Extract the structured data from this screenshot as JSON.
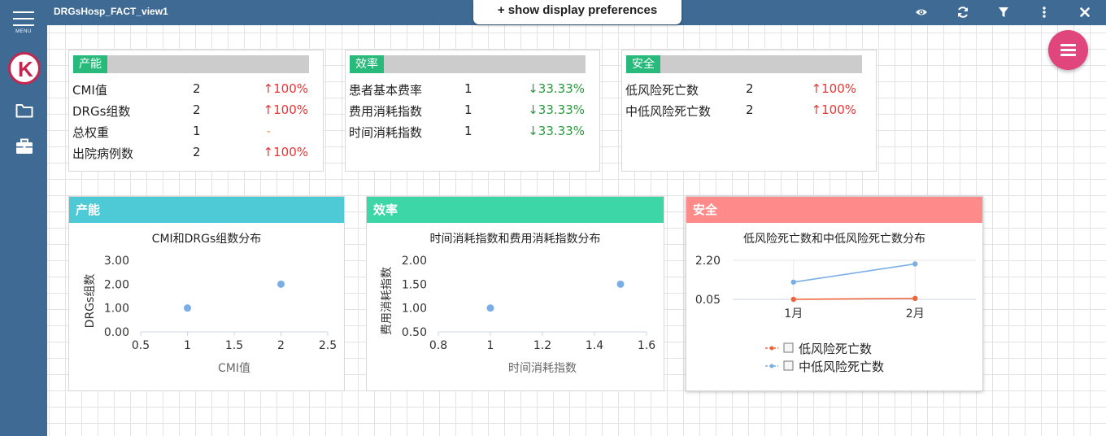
{
  "app": {
    "menu_label": "MENU",
    "view_title": "DRGsHosp_FACT_view1",
    "prefs_label": "+ show display preferences",
    "logo_letter": "K"
  },
  "icons": [
    "menu-icon",
    "folder-icon",
    "briefcase-icon",
    "eye-icon",
    "refresh-icon",
    "filter-icon",
    "more-vert-icon",
    "close-icon",
    "hamburger-icon"
  ],
  "colors": {
    "nav": "#3e6a93",
    "fab": "#e0457b",
    "kpi_tag": "#27ba7b",
    "capacity": "#4ec9d6",
    "efficiency": "#3dd6a7",
    "safety": "#ff8a8a",
    "up": "#ee3333",
    "down": "#2a9a3e",
    "series_low": "#f0643c",
    "series_midlow": "#7aaee6"
  },
  "kpis": [
    {
      "tag": "产能",
      "rows": [
        {
          "label": "CMI值",
          "value": "2",
          "change": "↑100%",
          "dir": "up"
        },
        {
          "label": "DRGs组数",
          "value": "2",
          "change": "↑100%",
          "dir": "up"
        },
        {
          "label": "总权重",
          "value": "1",
          "change": "-",
          "dir": "neutral"
        },
        {
          "label": "出院病例数",
          "value": "2",
          "change": "↑100%",
          "dir": "up"
        }
      ]
    },
    {
      "tag": "效率",
      "rows": [
        {
          "label": "患者基本费率",
          "value": "1",
          "change": "↓33.33%",
          "dir": "down"
        },
        {
          "label": "费用消耗指数",
          "value": "1",
          "change": "↓33.33%",
          "dir": "down"
        },
        {
          "label": "时间消耗指数",
          "value": "1",
          "change": "↓33.33%",
          "dir": "down"
        }
      ]
    },
    {
      "tag": "安全",
      "rows": [
        {
          "label": "低风险死亡数",
          "value": "2",
          "change": "↑100%",
          "dir": "up"
        },
        {
          "label": "中低风险死亡数",
          "value": "2",
          "change": "↑100%",
          "dir": "up"
        }
      ]
    }
  ],
  "charts": {
    "capacity_header": "产能",
    "efficiency_header": "效率",
    "safety_header": "安全"
  },
  "chart_data": [
    {
      "type": "scatter",
      "title": "CMI和DRGs组数分布",
      "xlabel": "CMI值",
      "ylabel": "DRGs组数",
      "xlim": [
        0.5,
        2.5
      ],
      "ylim": [
        0,
        3
      ],
      "xticks": [
        "0.5",
        "1",
        "1.5",
        "2",
        "2.5"
      ],
      "yticks": [
        "0.00",
        "1.00",
        "2.00",
        "3.00"
      ],
      "points": [
        {
          "x": 1,
          "y": 1
        },
        {
          "x": 2,
          "y": 2
        }
      ]
    },
    {
      "type": "scatter",
      "title": "时间消耗指数和费用消耗指数分布",
      "xlabel": "时间消耗指数",
      "ylabel": "费用消耗指数",
      "xlim": [
        0.8,
        1.6
      ],
      "ylim": [
        0.5,
        2
      ],
      "xticks": [
        "0.8",
        "1",
        "1.2",
        "1.4",
        "1.6"
      ],
      "yticks": [
        "0.50",
        "1.00",
        "1.50",
        "2.00"
      ],
      "points": [
        {
          "x": 1,
          "y": 1
        },
        {
          "x": 1.5,
          "y": 1.5
        }
      ]
    },
    {
      "type": "line",
      "title": "低风险死亡数和中低风险死亡数分布",
      "categories": [
        "1月",
        "2月"
      ],
      "yticks": [
        "0.05",
        "2.20"
      ],
      "ylim": [
        0.05,
        2.2
      ],
      "legend": "bottom",
      "series": [
        {
          "name": "低风险死亡数",
          "values": [
            0.05,
            0.1
          ]
        },
        {
          "name": "中低风险死亡数",
          "values": [
            1,
            2
          ]
        }
      ]
    }
  ]
}
